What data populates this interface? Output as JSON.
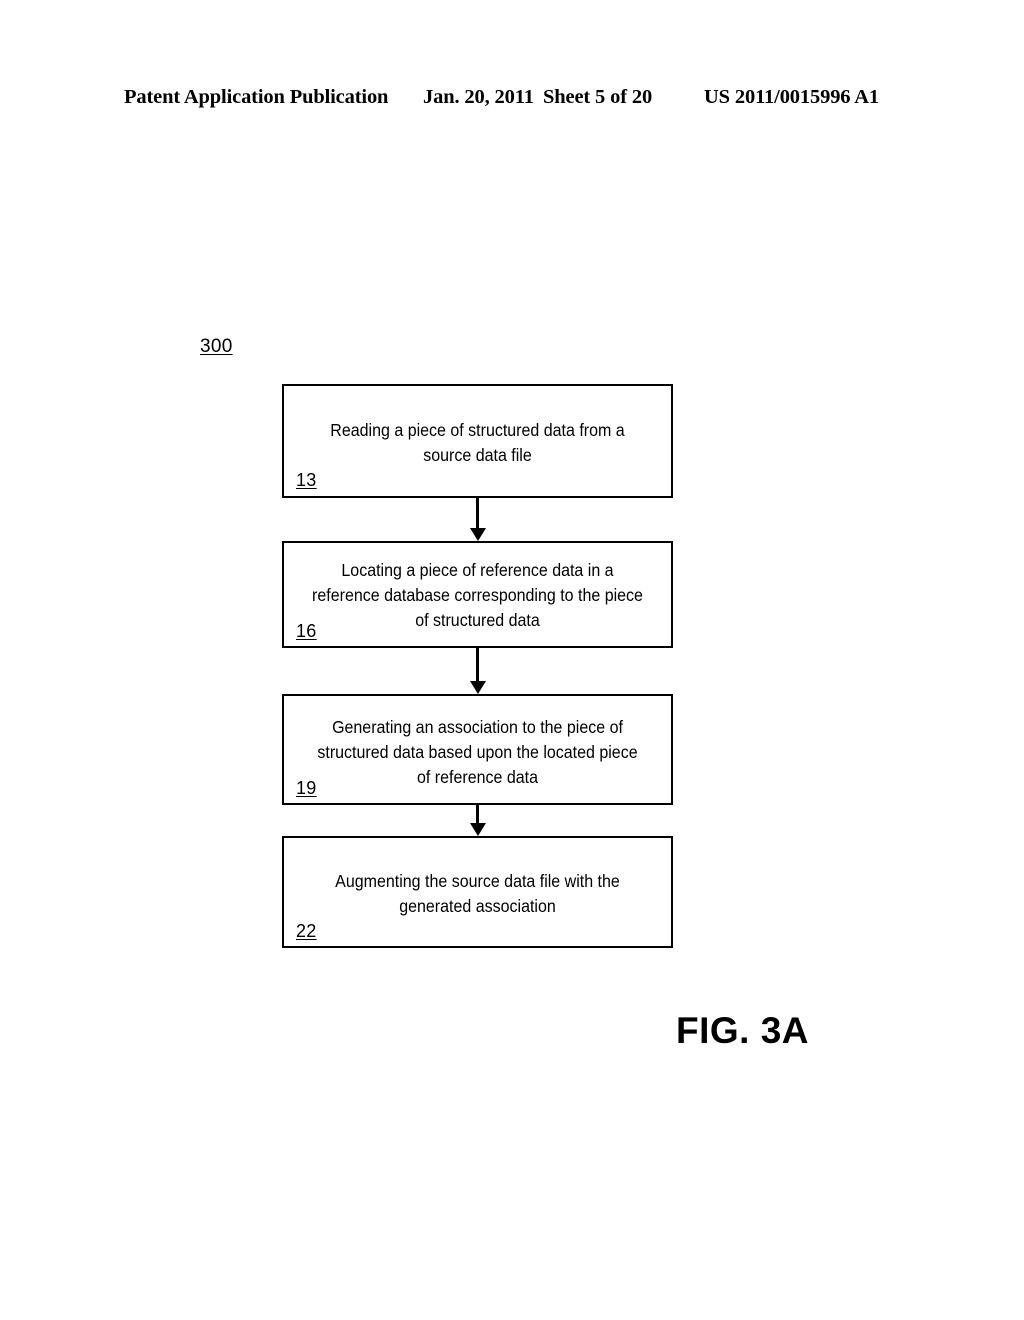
{
  "header": {
    "publication_label": "Patent Application Publication",
    "date": "Jan. 20, 2011",
    "sheet": "Sheet 5 of 20",
    "publication_number": "US 2011/0015996 A1"
  },
  "figure": {
    "reference_numeral": "300",
    "caption": "FIG. 3A"
  },
  "flowchart": {
    "steps": [
      {
        "ref": "13",
        "text": "Reading a piece of structured data from a source data file"
      },
      {
        "ref": "16",
        "text": "Locating a piece of reference data in a reference database corresponding to the piece of structured data"
      },
      {
        "ref": "19",
        "text": "Generating an association to the piece of structured data based upon the located piece of reference data"
      },
      {
        "ref": "22",
        "text": "Augmenting the source data file with the generated association"
      }
    ]
  },
  "colors": {
    "ink": "#000000",
    "paper": "#ffffff"
  }
}
